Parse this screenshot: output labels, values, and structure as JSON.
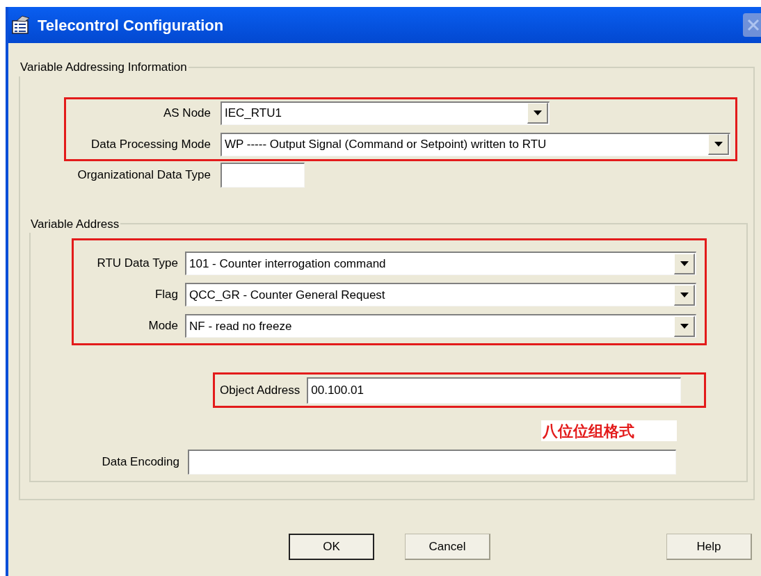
{
  "window": {
    "title": "Telecontrol Configuration"
  },
  "addressing": {
    "title": "Variable Addressing Information",
    "highlight": {
      "highlighted": true,
      "fields": [
        {
          "label": "AS Node",
          "value": "IEC_RTU1",
          "kind": "dropdown"
        },
        {
          "label": "Data Processing Mode",
          "value": "WP ----- Output Signal (Command or Setpoint) written to RTU",
          "kind": "dropdown"
        }
      ]
    },
    "org_field": {
      "label": "Organizational Data Type",
      "kind": "text"
    }
  },
  "variable_address": {
    "title": "Variable Address",
    "highlight": {
      "highlighted": true,
      "fields": [
        {
          "label": "RTU Data Type",
          "value": "101 - Counter interrogation command",
          "kind": "dropdown"
        },
        {
          "label": "Flag",
          "value": "QCC_GR - Counter General Request",
          "kind": "dropdown"
        },
        {
          "label": "Mode",
          "value": "NF - read no freeze",
          "kind": "dropdown"
        }
      ]
    },
    "object_address": {
      "label": "Object Address",
      "value": "00.100.01",
      "kind": "text",
      "highlighted": true
    },
    "note": "八位位组格式",
    "data_encoding": {
      "label": "Data Encoding",
      "kind": "text"
    }
  },
  "buttons": [
    {
      "label": "OK",
      "default": true
    },
    {
      "label": "Cancel",
      "default": false
    },
    {
      "label": "Help",
      "default": false
    }
  ]
}
